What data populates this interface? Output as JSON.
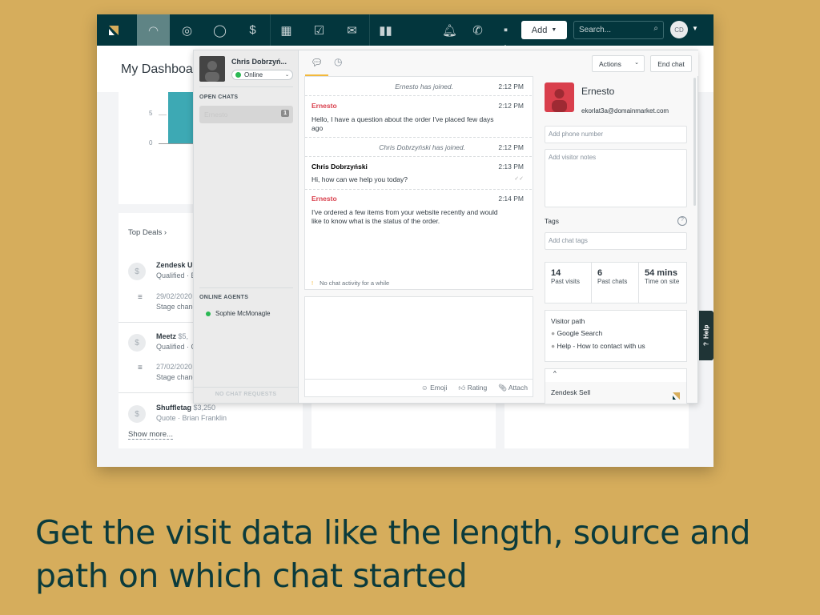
{
  "nav": {
    "items": [
      "logo",
      "dashboard",
      "leads",
      "contacts",
      "deals",
      "calendar",
      "tasks",
      "communications",
      "reports"
    ],
    "add_label": "Add",
    "search_placeholder": "Search...",
    "avatar_initials": "CD"
  },
  "dashboard": {
    "title": "My Dashboard",
    "chart_ticks": [
      "5",
      "0"
    ],
    "top_deals_label": "Top Deals",
    "deals": [
      {
        "name": "Zendesk U",
        "meta": "Qualified · B",
        "date": "29/02/2020",
        "activity": "Stage chang"
      },
      {
        "name": "Meetz",
        "amount": "$5,",
        "meta": "Qualified · C",
        "date": "27/02/2020",
        "activity": "Stage chang"
      },
      {
        "name": "Shuffletag",
        "amount": "$3,250",
        "meta": "Quote · Brian Franklin"
      }
    ],
    "show_more": "Show more..."
  },
  "chat": {
    "agent_name": "Chris Dobrzyń...",
    "status": "Online",
    "status_color": "#2ab853",
    "open_chats_label": "OPEN CHATS",
    "open_chats": [
      {
        "name": "Ernesto",
        "count": "1"
      }
    ],
    "online_agents_label": "ONLINE AGENTS",
    "online_agents": [
      "Sophie McMonagle"
    ],
    "no_requests": "NO CHAT REQUESTS",
    "actions_label": "Actions",
    "end_chat_label": "End chat",
    "messages": [
      {
        "type": "system",
        "text": "Ernesto has joined.",
        "time": "2:12 PM"
      },
      {
        "type": "visitor",
        "author": "Ernesto",
        "text": "Hello, I have a question about the order I've placed few days ago",
        "time": "2:12 PM"
      },
      {
        "type": "system",
        "text": "Chris Dobrzyński has joined.",
        "time": "2:12 PM"
      },
      {
        "type": "agent",
        "author": "Chris Dobrzyński",
        "text": "Hi, how can we help you today?",
        "time": "2:13 PM"
      },
      {
        "type": "visitor",
        "author": "Ernesto",
        "text": "I've ordered a few items from your website recently and would like to know what is the status of the order.",
        "time": "2:14 PM"
      }
    ],
    "inactivity": "No chat activity for a while",
    "composer": {
      "emoji": "Emoji",
      "rating": "Rating",
      "attach": "Attach"
    },
    "visitor": {
      "name": "Ernesto",
      "email": "ekorlat3a@domainmarket.com",
      "phone_placeholder": "Add phone number",
      "notes_placeholder": "Add visitor notes",
      "tags_label": "Tags",
      "tags_placeholder": "Add chat tags",
      "stats": [
        {
          "value": "14",
          "label": "Past visits"
        },
        {
          "value": "6",
          "label": "Past chats"
        },
        {
          "value": "54 mins",
          "label": "Time on site"
        }
      ],
      "path_label": "Visitor path",
      "path": [
        "Google Search",
        "Help - How to contact with us"
      ],
      "app_label": "Zendesk Sell"
    },
    "help_label": "Help"
  },
  "headline": "Get the visit data like the length, source and path on which chat started",
  "colors": {
    "background": "#D6AD5C",
    "nav": "#03363D",
    "visitor_red": "#d93f4c",
    "accent": "#f3b93b"
  }
}
